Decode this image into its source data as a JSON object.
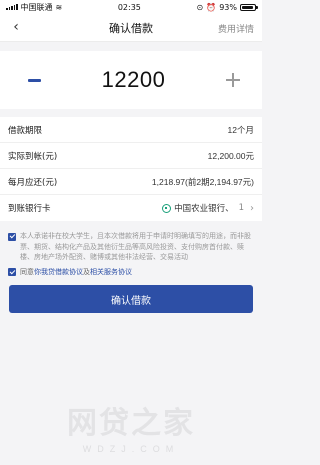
{
  "status_bar": {
    "carrier": "中国联通",
    "time": "02:35",
    "battery": "93%"
  },
  "nav": {
    "title": "确认借款",
    "right_link": "费用详情"
  },
  "amount": {
    "value": "12200"
  },
  "details": [
    {
      "label": "借款期限",
      "value": "12个月"
    },
    {
      "label": "实际到帐(元)",
      "value": "12,200.00元"
    },
    {
      "label": "每月应还(元)",
      "value": "1,218.97(前2期2,194.97元)"
    }
  ],
  "bank": {
    "label": "到账银行卡",
    "name": "中国农业银行、",
    "suffix": "1"
  },
  "agreements": {
    "commitment": "本人承诺非在校大学生，且本次借款将用于申请时明确填写的用途，而非股票、期货、结构化产品及其他衍生品等高风险投资、支付购房首付款、赎楼、房地产场外配资、赌博或其他非法经营、交易活动",
    "agree_prefix": "同意",
    "agree_link1": "你我贷借款协议",
    "agree_and": "及",
    "agree_link2": "相关服务协议"
  },
  "confirm_button": "确认借款",
  "watermark": {
    "cn": "网贷之家",
    "en": "WDZJ.COM"
  },
  "colors": {
    "primary": "#2d4fa6",
    "background": "#f4f4f6",
    "bank_logo": "#19a07a"
  }
}
